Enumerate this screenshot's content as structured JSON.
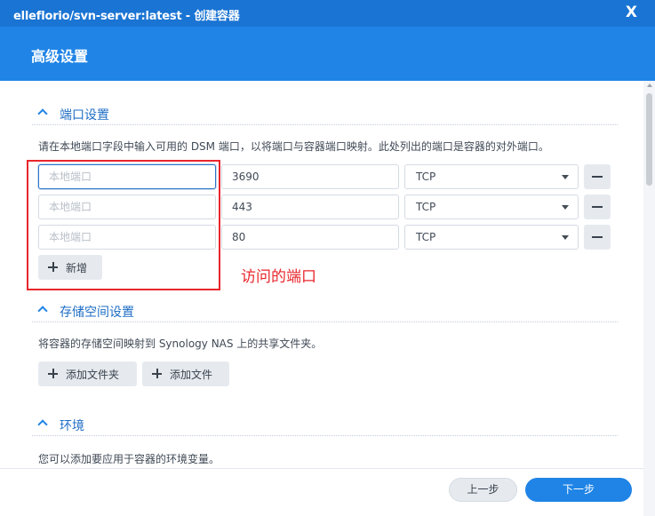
{
  "window": {
    "title": "elleflorio/svn-server:latest - 创建容器",
    "close_glyph": "X"
  },
  "header": {
    "title": "高级设置"
  },
  "ports_section": {
    "title": "端口设置",
    "description": "请在本地端口字段中输入可用的 DSM 端口，以将端口与容器端口映射。此处列出的端口是容器的对外端口。",
    "local_port_placeholder": "本地端口",
    "rows": [
      {
        "local": "",
        "container": "3690",
        "protocol": "TCP"
      },
      {
        "local": "",
        "container": "443",
        "protocol": "TCP"
      },
      {
        "local": "",
        "container": "80",
        "protocol": "TCP"
      }
    ],
    "add_label": "新增"
  },
  "annotation": {
    "text": "访问的端口",
    "color": "#e8262c"
  },
  "storage_section": {
    "title": "存储空间设置",
    "description": "将容器的存储空间映射到 Synology NAS 上的共享文件夹。",
    "add_folder_label": "添加文件夹",
    "add_file_label": "添加文件"
  },
  "env_section": {
    "title": "环境",
    "description": "您可以添加要应用于容器的环境变量。"
  },
  "footer": {
    "prev_label": "上一步",
    "next_label": "下一步"
  },
  "colors": {
    "accent": "#1f84e6",
    "titlebar": "#1a74d3",
    "annotation": "#e8262c"
  },
  "icons": [
    "close-icon",
    "chevron-up-icon",
    "minus-icon",
    "plus-icon",
    "dropdown-caret-icon"
  ]
}
